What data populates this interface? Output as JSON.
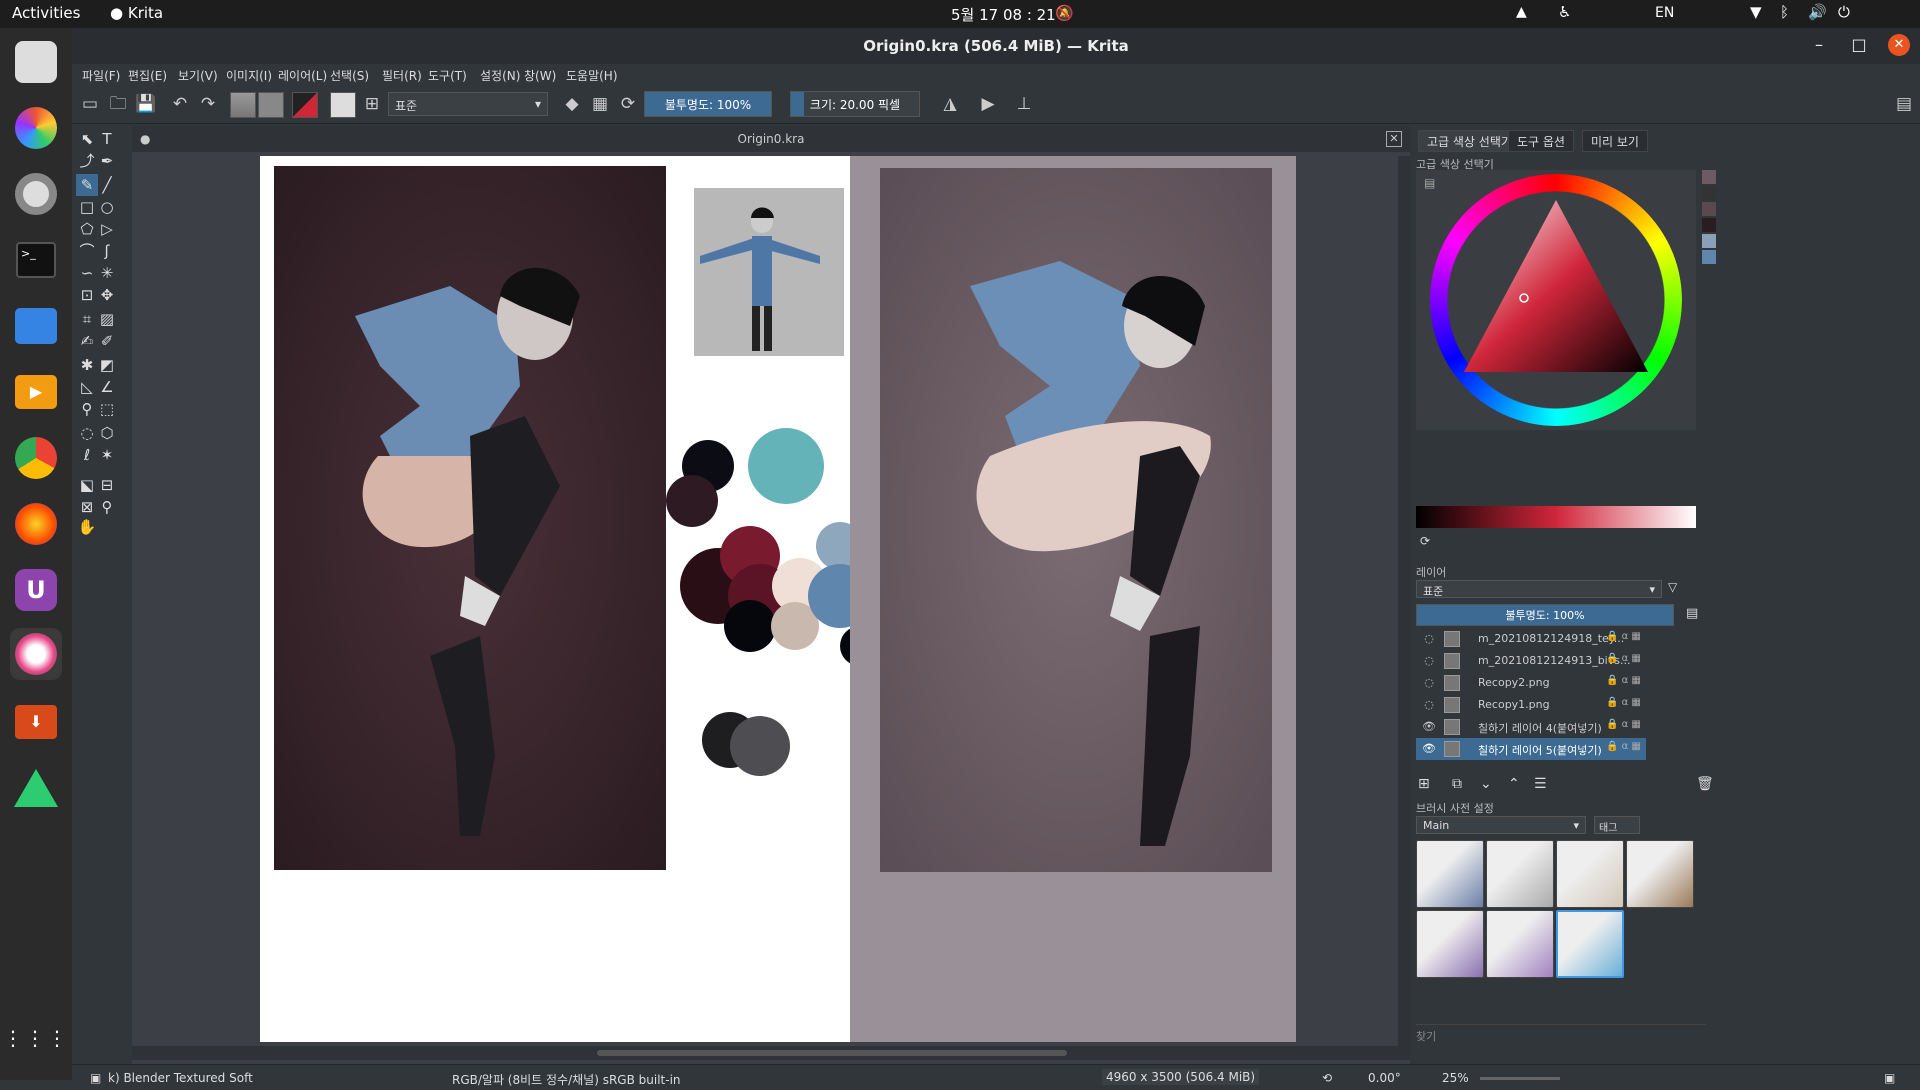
{
  "topbar": {
    "activities": "Activities",
    "app": "Krita",
    "clock": "5월 17 08 : 21",
    "lang": "EN"
  },
  "window": {
    "title": "Origin0.kra (506.4 MiB) — Krita"
  },
  "menu": [
    "파일(F)",
    "편집(E)",
    "보기(V)",
    "이미지(I)",
    "레이어(L)",
    "선택(S)",
    "필터(R)",
    "도구(T)",
    "설정(N)",
    "창(W)",
    "도움말(H)"
  ],
  "toolbar": {
    "blend_mode": "표준",
    "opacity": "불투명도: 100%",
    "opacity_value": 1.0,
    "size": "크기: 20.00 픽셀",
    "size_fill": 0.1
  },
  "document": {
    "tab": "Origin0.kra"
  },
  "docker_tabs": [
    "고급 색상 선택기",
    "도구 옵션",
    "미리 보기"
  ],
  "color_selector": {
    "title": "고급 색상 선택기",
    "accent": "#d0263a"
  },
  "layers": {
    "title": "레이어",
    "blend_mode": "표준",
    "opacity": "불투명도:  100%",
    "items": [
      {
        "name": "m_20210812124918_tey...",
        "visible": false,
        "selected": false
      },
      {
        "name": "m_20210812124913_bivs...",
        "visible": false,
        "selected": false
      },
      {
        "name": "Recopy2.png",
        "visible": false,
        "selected": false
      },
      {
        "name": "Recopy1.png",
        "visible": false,
        "selected": false
      },
      {
        "name": "칠하기 레이어 4(붙여넣기)",
        "visible": true,
        "selected": false
      },
      {
        "name": "칠하기 레이어 5(붙여넣기)",
        "visible": true,
        "selected": true
      }
    ]
  },
  "brush_presets": {
    "title": "브러시 사전 설정",
    "tag_group": "Main",
    "tag_button": "태그",
    "search_placeholder": "찾기"
  },
  "status": {
    "brush": "k) Blender Textured Soft",
    "color_model": "RGB/알파 (8비트 정수/채널)  sRGB built-in",
    "dimensions": "4960 x 3500 (506.4 MiB)",
    "rotation": "0.00°",
    "zoom": "25%"
  },
  "icons": [
    "krita-icon",
    "settings-icon",
    "terminal-icon",
    "files-icon",
    "video-icon",
    "chrome-icon",
    "firefox-icon",
    "u-icon",
    "krita-active-icon",
    "download-icon",
    "toolbox-icon",
    "apps-grid-icon"
  ]
}
